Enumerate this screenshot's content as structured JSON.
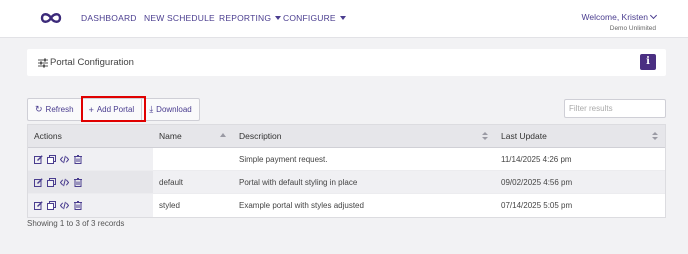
{
  "nav": {
    "items": [
      {
        "label": "DASHBOARD",
        "has_dropdown": false
      },
      {
        "label": "NEW SCHEDULE",
        "has_dropdown": false
      },
      {
        "label": "REPORTING",
        "has_dropdown": true
      },
      {
        "label": "CONFIGURE",
        "has_dropdown": true
      }
    ],
    "welcome": "Welcome, Kristen",
    "org": "Demo Unlimited",
    "logo_icon": "infinity-icon",
    "brand_color": "#4a3d8f"
  },
  "page": {
    "title": "Portal Configuration",
    "title_icon": "sliders-icon",
    "info_button": "i"
  },
  "toolbar": {
    "refresh_label": "Refresh",
    "add_label": "Add Portal",
    "download_label": "Download",
    "filter_placeholder": "Filter results",
    "highlight_color": "#e00000"
  },
  "table": {
    "columns": [
      "Actions",
      "Name",
      "Description",
      "Last Update"
    ],
    "rows": [
      {
        "name": "",
        "description": "Simple payment request.",
        "last_update": "11/14/2025 4:26 pm"
      },
      {
        "name": "default",
        "description": "Portal with default styling in place",
        "last_update": "09/02/2025 4:56 pm"
      },
      {
        "name": "styled",
        "description": "Example portal with styles adjusted",
        "last_update": "07/14/2025 5:05 pm"
      }
    ],
    "action_icons": [
      "edit-icon",
      "copy-icon",
      "code-icon",
      "trash-icon"
    ],
    "summary": "Showing 1 to 3 of 3 records"
  }
}
